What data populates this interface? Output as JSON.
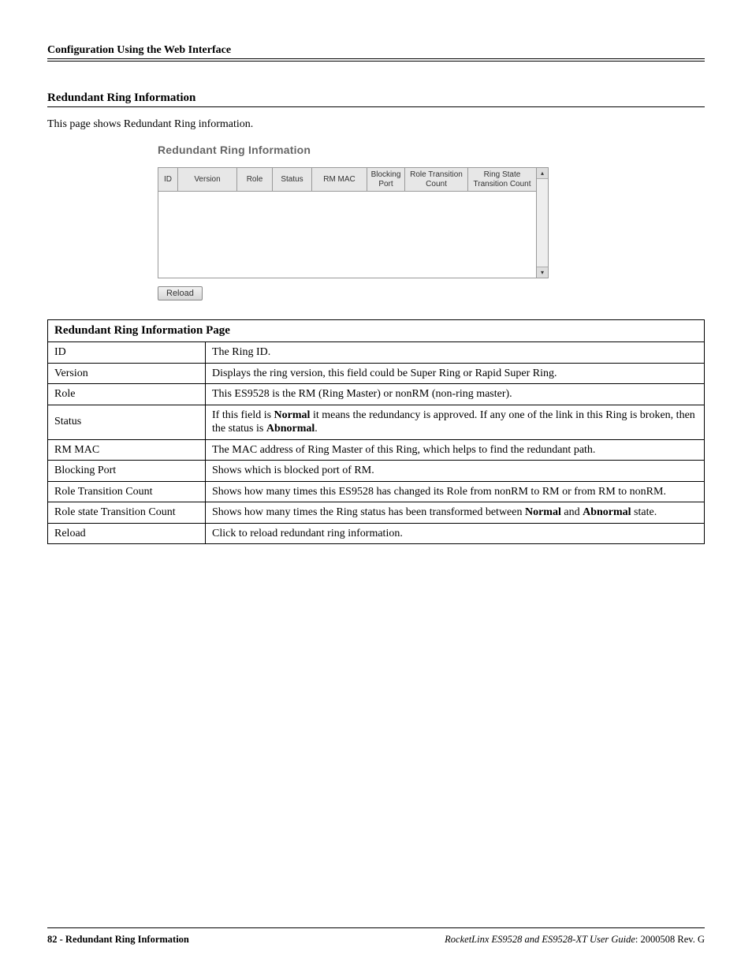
{
  "header": {
    "title": "Configuration Using the Web Interface"
  },
  "section": {
    "title": "Redundant Ring Information",
    "intro": "This page shows Redundant Ring information."
  },
  "screenshot": {
    "title": "Redundant Ring Information",
    "columns": {
      "c0": "ID",
      "c1": "Version",
      "c2": "Role",
      "c3": "Status",
      "c4": "RM MAC",
      "c5": "Blocking Port",
      "c6": "Role Transition Count",
      "c7": "Ring State Transition Count"
    },
    "reload_label": "Reload"
  },
  "desc": {
    "header": "Redundant Ring Information Page",
    "rows": {
      "r0": {
        "label": "ID",
        "value": "The Ring ID."
      },
      "r1": {
        "label": "Version",
        "value": "Displays the ring version, this field could be Super Ring or Rapid Super Ring."
      },
      "r2": {
        "label": "Role",
        "value": "This ES9528 is the RM (Ring Master) or nonRM (non-ring master)."
      },
      "r3": {
        "label": "Status",
        "p1": "If this field is ",
        "b1": "Normal",
        "p2": " it means the redundancy is approved. If any one of the link in this Ring is broken, then the status is ",
        "b2": "Abnormal",
        "p3": "."
      },
      "r4": {
        "label": "RM MAC",
        "value": "The MAC address of Ring Master of this Ring, which helps to find the redundant path."
      },
      "r5": {
        "label": "Blocking Port",
        "value": "Shows which is blocked port of RM."
      },
      "r6": {
        "label": "Role Transition Count",
        "value": "Shows how many times this ES9528 has changed its Role from nonRM to RM or from RM to nonRM."
      },
      "r7": {
        "label": "Role state Transition Count",
        "p1": "Shows how many times the Ring status has been transformed between ",
        "b1": "Normal",
        "p2": " and ",
        "b2": "Abnormal",
        "p3": " state."
      },
      "r8": {
        "label": "Reload",
        "value": "Click to reload redundant ring information."
      }
    }
  },
  "footer": {
    "left": "82 - Redundant Ring Information",
    "right_em": "RocketLinx ES9528 and ES9528-XT User Guide",
    "right_tail": ": 2000508 Rev. G"
  }
}
